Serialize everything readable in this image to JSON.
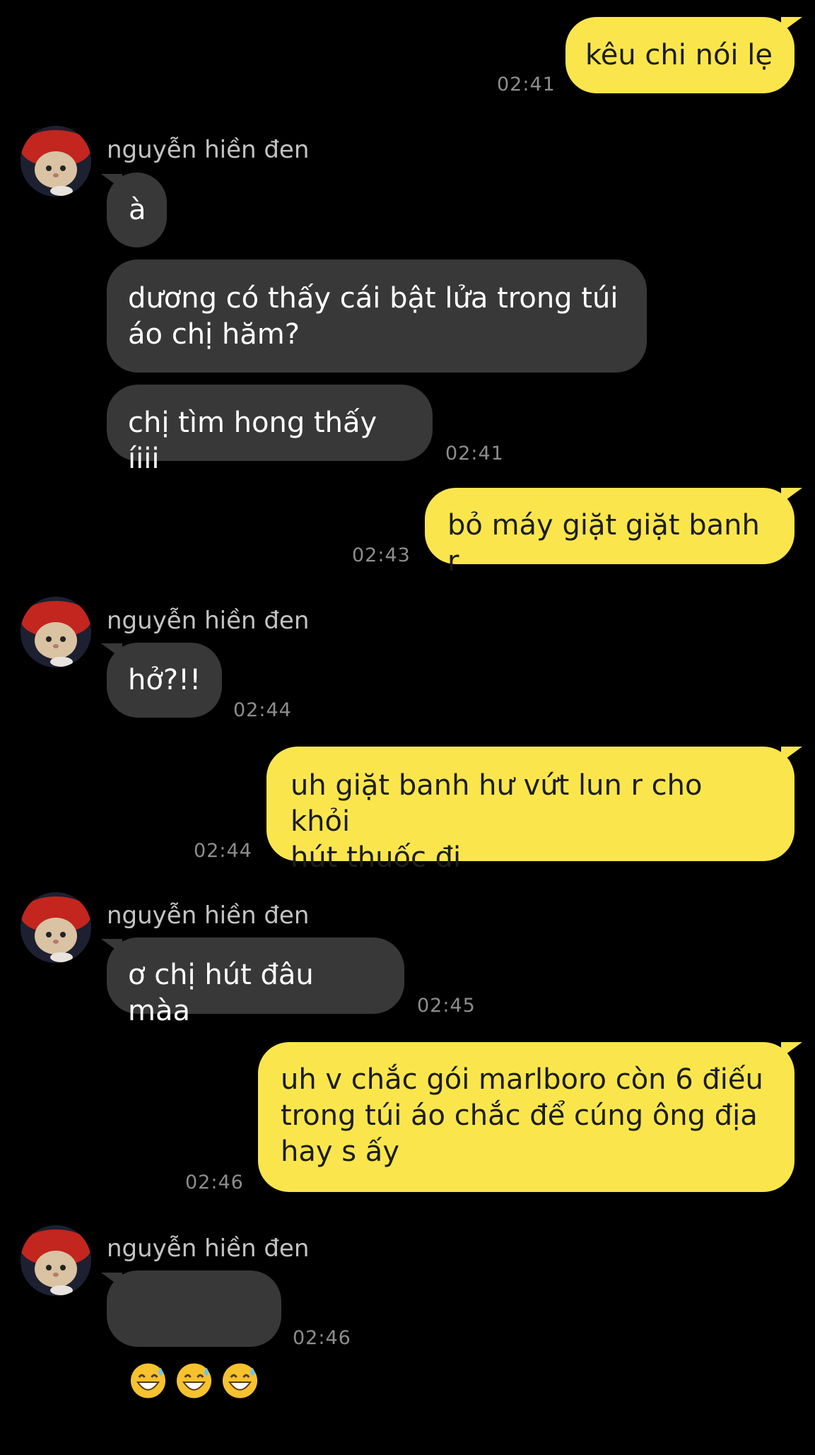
{
  "contact": {
    "name": "nguyễn hiền đen"
  },
  "messages": [
    {
      "from": "me",
      "text": "kêu chi nói lẹ",
      "time": "02:41"
    },
    {
      "from": "them",
      "text": "à"
    },
    {
      "from": "them",
      "text": "dương có thấy cái bật lửa trong túi\náo chị hăm?"
    },
    {
      "from": "them",
      "text": "chị tìm hong thấy íiii",
      "time": "02:41"
    },
    {
      "from": "me",
      "text": "bỏ máy giặt giặt banh r",
      "time": "02:43"
    },
    {
      "from": "them",
      "text": "hở?!!",
      "time": "02:44"
    },
    {
      "from": "me",
      "text": "uh giặt banh hư vứt lun r cho khỏi\nhút thuốc đi",
      "time": "02:44"
    },
    {
      "from": "them",
      "text": "ơ chị hút đâu màa",
      "time": "02:45"
    },
    {
      "from": "me",
      "text": "uh v chắc gói marlboro còn 6 điếu\ntrong túi áo chắc để cúng ông địa\nhay s ấy",
      "time": "02:46"
    },
    {
      "from": "them",
      "text": "😅😅😅",
      "emoji": "grinning-face-with-sweat",
      "time": "02:46"
    }
  ],
  "colors": {
    "my_bubble": "#fae64c",
    "their_bubble": "#383838",
    "background": "#000000"
  }
}
